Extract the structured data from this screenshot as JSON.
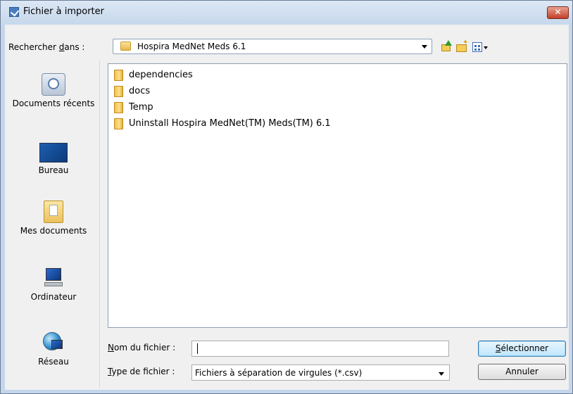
{
  "window": {
    "title": "Fichier à importer",
    "close_label": "✕"
  },
  "lookin": {
    "label_prefix": "Rechercher ",
    "label_access": "d",
    "label_rest": "ans :",
    "value": "Hospira MedNet Meds 6.1"
  },
  "toolbar": {
    "up_icon": "up-folder-icon",
    "new_folder_icon": "new-folder-icon",
    "view_icon": "view-menu-icon"
  },
  "places": [
    {
      "label": "Documents récents",
      "icon": "recent-documents-icon"
    },
    {
      "label": "Bureau",
      "icon": "desktop-icon"
    },
    {
      "label": "Mes documents",
      "icon": "my-documents-icon"
    },
    {
      "label": "Ordinateur",
      "icon": "computer-icon"
    },
    {
      "label": "Réseau",
      "icon": "network-icon"
    }
  ],
  "files": [
    {
      "name": "dependencies",
      "type": "folder"
    },
    {
      "name": "docs",
      "type": "folder"
    },
    {
      "name": "Temp",
      "type": "folder"
    },
    {
      "name": "Uninstall Hospira MedNet(TM) Meds(TM) 6.1",
      "type": "folder"
    }
  ],
  "filename": {
    "label_access": "N",
    "label_rest": "om du fichier :",
    "value": ""
  },
  "filetype": {
    "label_access": "T",
    "label_rest": "ype de fichier :",
    "value": "Fichiers à séparation de virgules (*.csv)"
  },
  "buttons": {
    "select_access": "S",
    "select_rest": "électionner",
    "cancel": "Annuler"
  }
}
